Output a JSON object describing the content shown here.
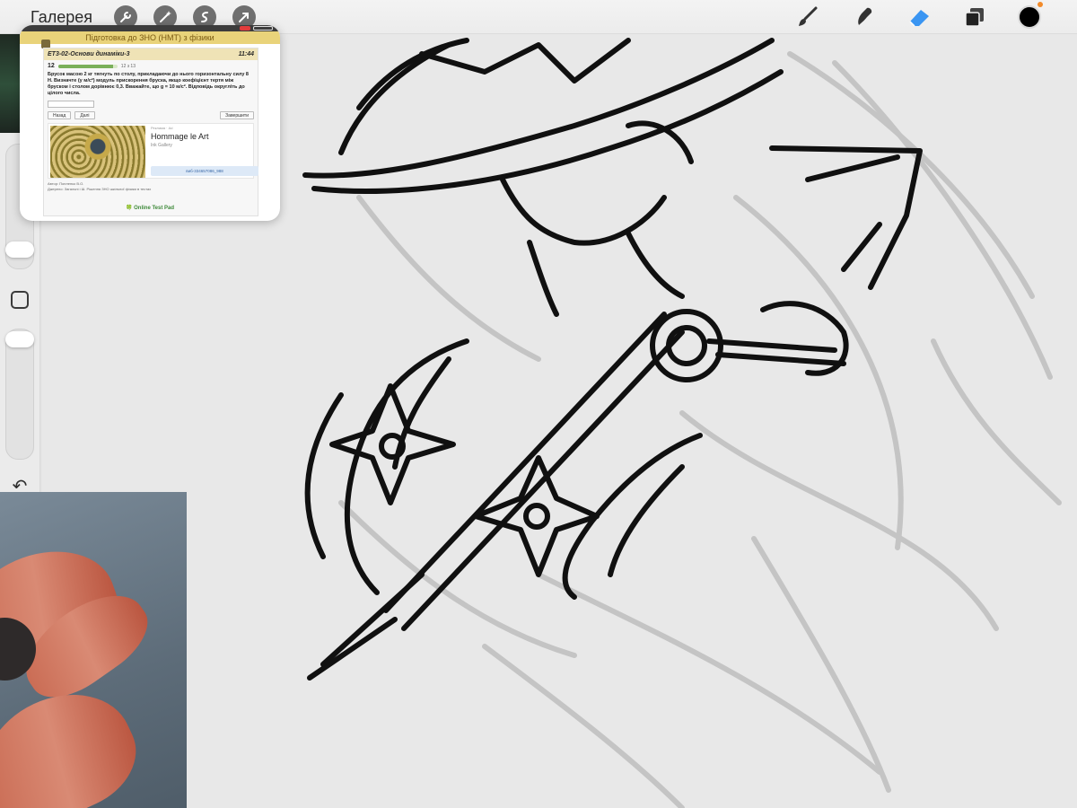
{
  "topbar": {
    "gallery_label": "Галерея",
    "left_tools": [
      "wrench-icon",
      "magic-wand-icon",
      "selection-icon",
      "transform-arrow-icon"
    ],
    "right_tools": [
      "brush-icon",
      "smudge-icon",
      "eraser-icon",
      "layers-icon"
    ],
    "current_color": "#000000",
    "accent_color": "#2f8ff0"
  },
  "sidebar": {
    "brush_size_level": 0.25,
    "opacity_level": 1.0
  },
  "pip": {
    "title": "Підготовка до ЗНО (НМТ) з фізики",
    "test_name": "ЕТ3-02-Основи динаміки-3",
    "timer": "11:44",
    "question_number": "12",
    "progress_text": "12 з 13",
    "progress_fraction": 0.92,
    "question_text": "Брусок масою 2 кг тягнуть по столу, прикладаючи до нього горизонтальну силу 8 Н. Визначте (у м/с²) модуль прискорення бруска, якщо коефіцієнт тертя між бруском і столом дорівнює 0,3. Вважайте, що g = 10 м/с². Відповідь округліть до цілого числа.",
    "back_button": "Назад",
    "next_button": "Далі",
    "finish_button": "Завершити",
    "ad_small": "Реклама · Ad",
    "ad_title": "Hommage le Art",
    "ad_subtitle": "Ink Gallery",
    "ad_button": "виб-334657086_988",
    "author_line": "Автор: Попленко В.О.",
    "source_line": "Джерело: Загальні і Ш. Рішення ЗНО шкільної фізики в тестах",
    "powered_by": "Online Test Pad"
  }
}
